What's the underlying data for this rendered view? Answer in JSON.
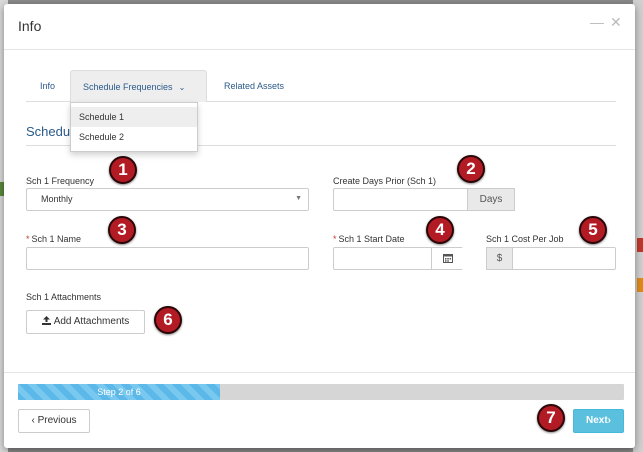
{
  "modal": {
    "title": "Info",
    "minimize_icon": "—",
    "close_icon": "✕"
  },
  "tabs": [
    {
      "label": "Info"
    },
    {
      "label": "Schedule Frequencies",
      "caret": "⌄"
    },
    {
      "label": "Related Assets"
    }
  ],
  "dropdown": {
    "items": [
      "Schedule 1",
      "Schedule 2"
    ],
    "active_index": 0
  },
  "section": {
    "title": "Schedu"
  },
  "form": {
    "frequency": {
      "label": "Sch 1 Frequency",
      "value": "Monthly",
      "arrow": "▼"
    },
    "days_prior": {
      "label": "Create Days Prior (Sch 1)",
      "value": "",
      "addon": "Days"
    },
    "name": {
      "required_mark": "*",
      "label": "Sch 1 Name",
      "value": ""
    },
    "start_date": {
      "required_mark": "*",
      "label": "Sch 1 Start Date",
      "value": "",
      "calendar_icon": "calendar-icon"
    },
    "cost_per_job": {
      "label": "Sch 1 Cost Per Job",
      "addon": "$",
      "value": ""
    },
    "attachments": {
      "label": "Sch 1 Attachments",
      "button_label": "Add Attachments",
      "button_icon": "upload-icon"
    }
  },
  "progress": {
    "label": "Step 2 of 6",
    "current_step": 2,
    "total_steps": 6,
    "fill_fraction": 0.333
  },
  "footer": {
    "previous_label": "Previous",
    "previous_icon": "‹",
    "next_label": "Next",
    "next_icon": "›"
  },
  "badges": [
    "1",
    "2",
    "3",
    "4",
    "5",
    "6",
    "7"
  ],
  "colors": {
    "badge": "#b31b24",
    "link": "#2a5a8a",
    "next_button": "#5bc0de",
    "progress": "#5bb8e8"
  }
}
